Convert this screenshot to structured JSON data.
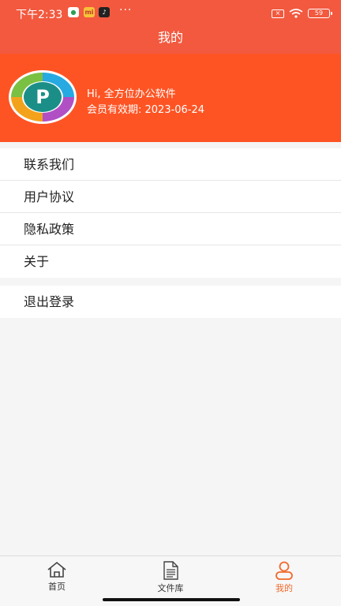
{
  "status_bar": {
    "time": "下午2:33",
    "apps": [
      "●",
      "mi",
      "♪"
    ],
    "dots": "···",
    "sim_label": "×",
    "battery": "59"
  },
  "header": {
    "title": "我的"
  },
  "profile": {
    "greeting": "Hi, 全方位办公软件",
    "expiry": "会员有效期: 2023-06-24",
    "avatar_letter": "P"
  },
  "menu": {
    "group1": [
      "联系我们",
      "用户协议",
      "隐私政策",
      "关于"
    ],
    "group2": [
      "退出登录"
    ]
  },
  "tabs": [
    {
      "label": "首页",
      "icon": "home-icon"
    },
    {
      "label": "文件库",
      "icon": "file-icon"
    },
    {
      "label": "我的",
      "icon": "user-icon",
      "active": true
    }
  ],
  "colors": {
    "header": "#f2593f",
    "profile": "#fe5424",
    "active_tab": "#f06a2e"
  }
}
